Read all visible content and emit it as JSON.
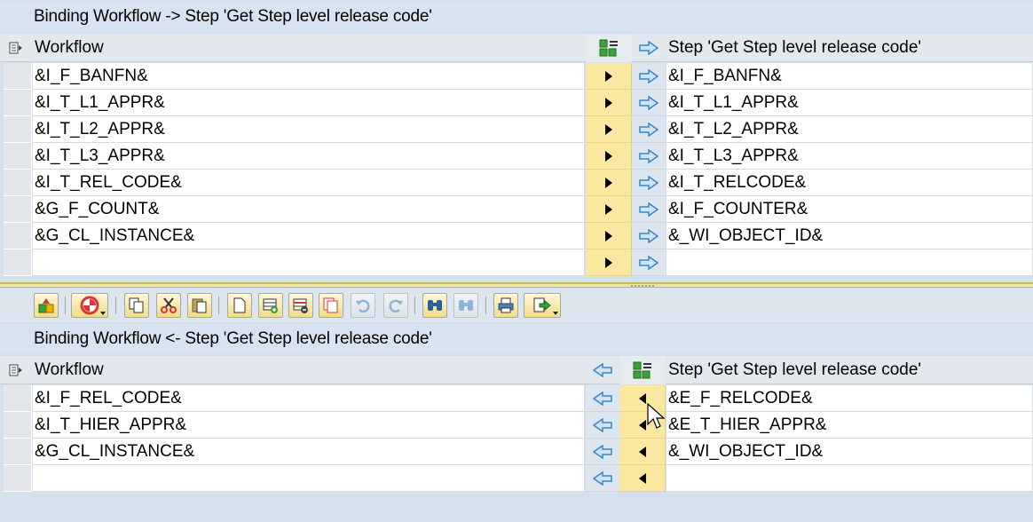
{
  "export_section": {
    "title": "Binding Workflow  -> Step 'Get Step level release code'",
    "col_left_header": "Workflow",
    "col_right_header": "Step 'Get Step level release code'",
    "rows": [
      {
        "left": "&I_F_BANFN&",
        "right": "&I_F_BANFN&"
      },
      {
        "left": "&I_T_L1_APPR&",
        "right": "&I_T_L1_APPR&"
      },
      {
        "left": "&I_T_L2_APPR&",
        "right": "&I_T_L2_APPR&"
      },
      {
        "left": "&I_T_L3_APPR&",
        "right": "&I_T_L3_APPR&"
      },
      {
        "left": "&I_T_REL_CODE&",
        "right": "&I_T_RELCODE&"
      },
      {
        "left": "&G_F_COUNT&",
        "right": "&I_F_COUNTER&"
      },
      {
        "left": "&G_CL_INSTANCE&",
        "right": "&_WI_OBJECT_ID&"
      },
      {
        "left": "",
        "right": ""
      }
    ]
  },
  "import_section": {
    "title": "Binding Workflow  <- Step 'Get Step level release code'",
    "col_left_header": "Workflow",
    "col_right_header": "Step 'Get Step level release code'",
    "rows": [
      {
        "left": "&I_F_REL_CODE&",
        "right": "&E_F_RELCODE&"
      },
      {
        "left": "&I_T_HIER_APPR&",
        "right": "&E_T_HIER_APPR&"
      },
      {
        "left": "&G_CL_INSTANCE&",
        "right": "&_WI_OBJECT_ID&"
      },
      {
        "left": "",
        "right": ""
      }
    ]
  },
  "toolbar": {
    "buttons": [
      "expression-icon",
      "stop-icon",
      "copy-icon",
      "cut-icon",
      "paste-icon",
      "new-icon",
      "insert-row-icon",
      "delete-row-icon",
      "duplicate-icon",
      "undo-icon",
      "redo-icon",
      "find-icon",
      "find-next-icon",
      "print-icon",
      "export-icon"
    ]
  },
  "colors": {
    "background": "#d4e1ec",
    "yellow_cell": "#fbe8a0",
    "arrow_blue": "#3b86c8"
  }
}
